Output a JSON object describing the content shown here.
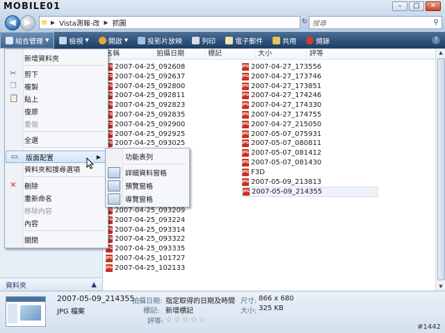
{
  "watermark": "MOBILE01",
  "address": {
    "segments": [
      "Vista測報-改",
      "抓圖"
    ]
  },
  "search": {
    "placeholder": "搜尋"
  },
  "toolbar": {
    "organize": "組合管理",
    "views": "檢視",
    "open": "開啟",
    "slideshow": "投影片放映",
    "print": "列印",
    "email": "電子郵件",
    "share": "共用",
    "burn": "燒錄"
  },
  "columns": [
    "名稱",
    "拍攝日期",
    "標記",
    "大小",
    "評等"
  ],
  "files_left_top": [
    "2007-04-25_092608",
    "2007-04-25_092637",
    "2007-04-25_092800",
    "2007-04-25_092811",
    "2007-04-25_092823",
    "2007-04-25_092835",
    "2007-04-25_092900",
    "2007-04-25_092925",
    "2007-04-25_093025"
  ],
  "files_left_bottom": [
    "2007-04-25_093209",
    "2007-04-25_093224",
    "2007-04-25_093314",
    "2007-04-25_093322",
    "2007-04-25_093335",
    "2007-04-25_101727",
    "2007-04-25_102133"
  ],
  "files_right": [
    "2007-04-27_173556",
    "2007-04-27_173746",
    "2007-04-27_173851",
    "2007-04-27_174246",
    "2007-04-27_174330",
    "2007-04-27_174755",
    "2007-04-27_215050",
    "2007-05-07_075931",
    "2007-05-07_080811",
    "2007-05-07_081412",
    "2007-05-07_081430",
    "F3D",
    "2007-05-09_213813",
    "2007-05-09_214355"
  ],
  "menu": {
    "new_folder": "新增資料夾",
    "cut": "剪下",
    "copy": "複製",
    "paste": "貼上",
    "undo": "復原",
    "redo": "重做",
    "select_all": "全選",
    "layout": "版面配置",
    "folder_options": "資料夾和搜尋選項",
    "delete": "刪除",
    "rename": "重新命名",
    "remove_properties": "移除內容",
    "properties": "內容",
    "close": "關閉"
  },
  "submenu": {
    "menu_bar": "功能表列",
    "details_pane": "詳細資料窗格",
    "preview_pane": "預覽窗格",
    "navigation_pane": "導覽窗格"
  },
  "folders_label": "資料夾",
  "details": {
    "name": "2007-05-09_214355",
    "type": "JPG 檔案",
    "date_label": "拍攝日期:",
    "date_value": "指定取得的日期及時間",
    "tags_label": "標記:",
    "tags_value": "新增標記",
    "rating_label": "評等:",
    "dimensions_label": "尺寸:",
    "dimensions_value": "866 x 680",
    "size_label": "大小:",
    "size_value": "325 KB",
    "stars": "☆☆☆☆☆"
  },
  "post_tag": "#1442",
  "colors": {
    "toolbar": "#2e5179",
    "file_icon": "#c8301f"
  }
}
